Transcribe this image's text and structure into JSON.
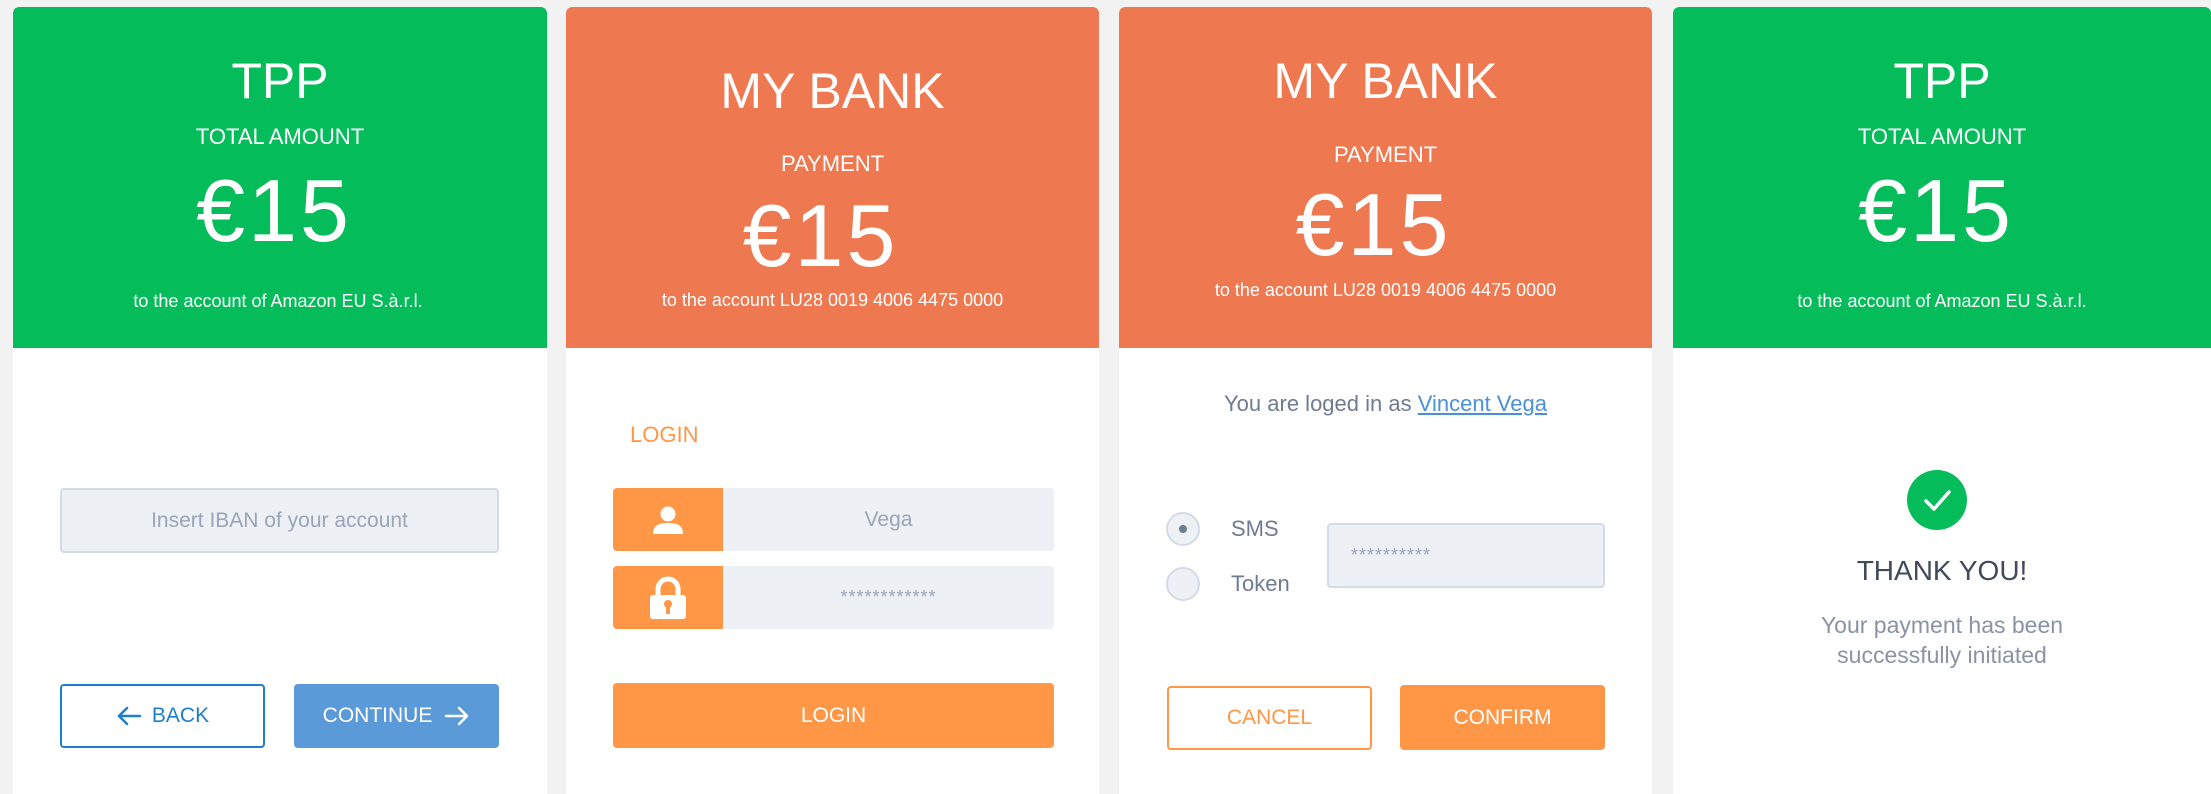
{
  "panel_tpp_start": {
    "title": "TPP",
    "subtitle": "TOTAL AMOUNT",
    "amount": "€15",
    "account_line": "to the account of Amazon EU S.à.r.l.",
    "iban_placeholder": "Insert IBAN of  your account",
    "back_label": "BACK",
    "continue_label": "CONTINUE"
  },
  "panel_bank_login": {
    "title": "MY  BANK",
    "subtitle": "PAYMENT",
    "amount": "€15",
    "account_line": "to the account  LU28 0019 4006 4475 0000",
    "section_label": "LOGIN",
    "username_value": "Vega",
    "password_value": "************",
    "login_button_label": "LOGIN"
  },
  "panel_bank_confirm": {
    "title": "MY  BANK",
    "subtitle": "PAYMENT",
    "amount": "€15",
    "account_line": "to the account  LU28 0019 4006 4475 0000",
    "logged_in_text": "You are loged in as ",
    "user_link": "Vincent Vega",
    "options": [
      {
        "label": "SMS",
        "selected": true
      },
      {
        "label": "Token",
        "selected": false
      }
    ],
    "code_value": "**********",
    "cancel_label": "CANCEL",
    "confirm_label": "CONFIRM"
  },
  "panel_tpp_done": {
    "title": "TPP",
    "subtitle": "TOTAL AMOUNT",
    "amount": "€15",
    "account_line": "to the account of Amazon EU S.à.r.l.",
    "thank_you": "THANK YOU!",
    "message_line1": "Your payment has been",
    "message_line2": "successfully initiated"
  },
  "colors": {
    "tpp_green": "#04bd5a",
    "bank_orange": "#ee7850",
    "accent_orange": "#ff9747",
    "accent_blue": "#5b9ad8",
    "link_blue": "#1f7ec9",
    "background": "#f2f2f2"
  },
  "icons": [
    "arrow-left-icon",
    "arrow-right-icon",
    "user-icon",
    "lock-icon",
    "checkmark-icon"
  ]
}
